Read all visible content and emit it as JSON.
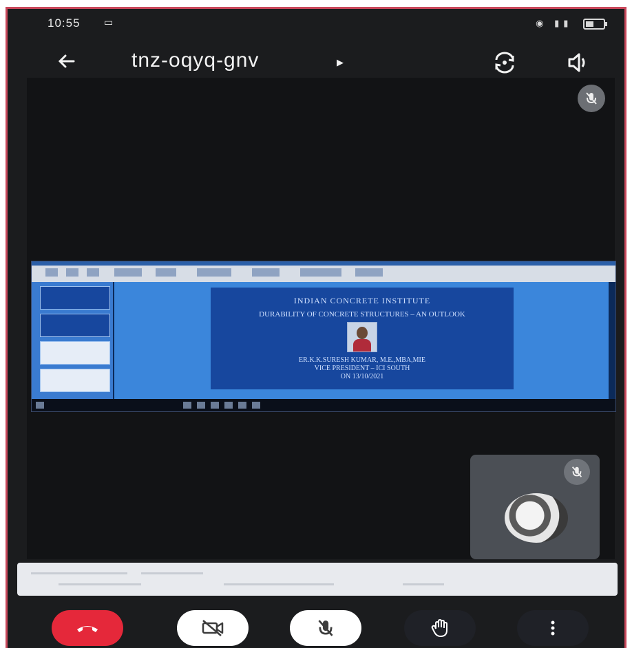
{
  "status_bar": {
    "time": "10:55",
    "icons": [
      "cast-icon",
      "wifi-icon",
      "signal-icon",
      "battery-icon"
    ]
  },
  "app_bar": {
    "meeting_code": "tnz-oqyq-gnv",
    "icons": [
      "back-arrow-icon",
      "caret-right-icon",
      "switch-camera-icon",
      "speaker-icon"
    ]
  },
  "presentation_slide": {
    "org": "INDIAN CONCRETE INSTITUTE",
    "title": "DURABILITY OF CONCRETE STRUCTURES – AN OUTLOOK",
    "speaker_line1": "ER.K.K.SURESH KUMAR, M.E.,MBA,MIE",
    "speaker_line2": "VICE PRESIDENT – ICI SOUTH",
    "speaker_line3": "ON 13/10/2021"
  },
  "controls": {
    "icons": [
      "phone-hangup-icon",
      "video-off-icon",
      "mic-off-icon",
      "raise-hand-icon",
      "more-vertical-icon"
    ]
  },
  "colors": {
    "end_call": "#e5283a",
    "frame": "#c9485b",
    "background": "#1b1c1e"
  }
}
